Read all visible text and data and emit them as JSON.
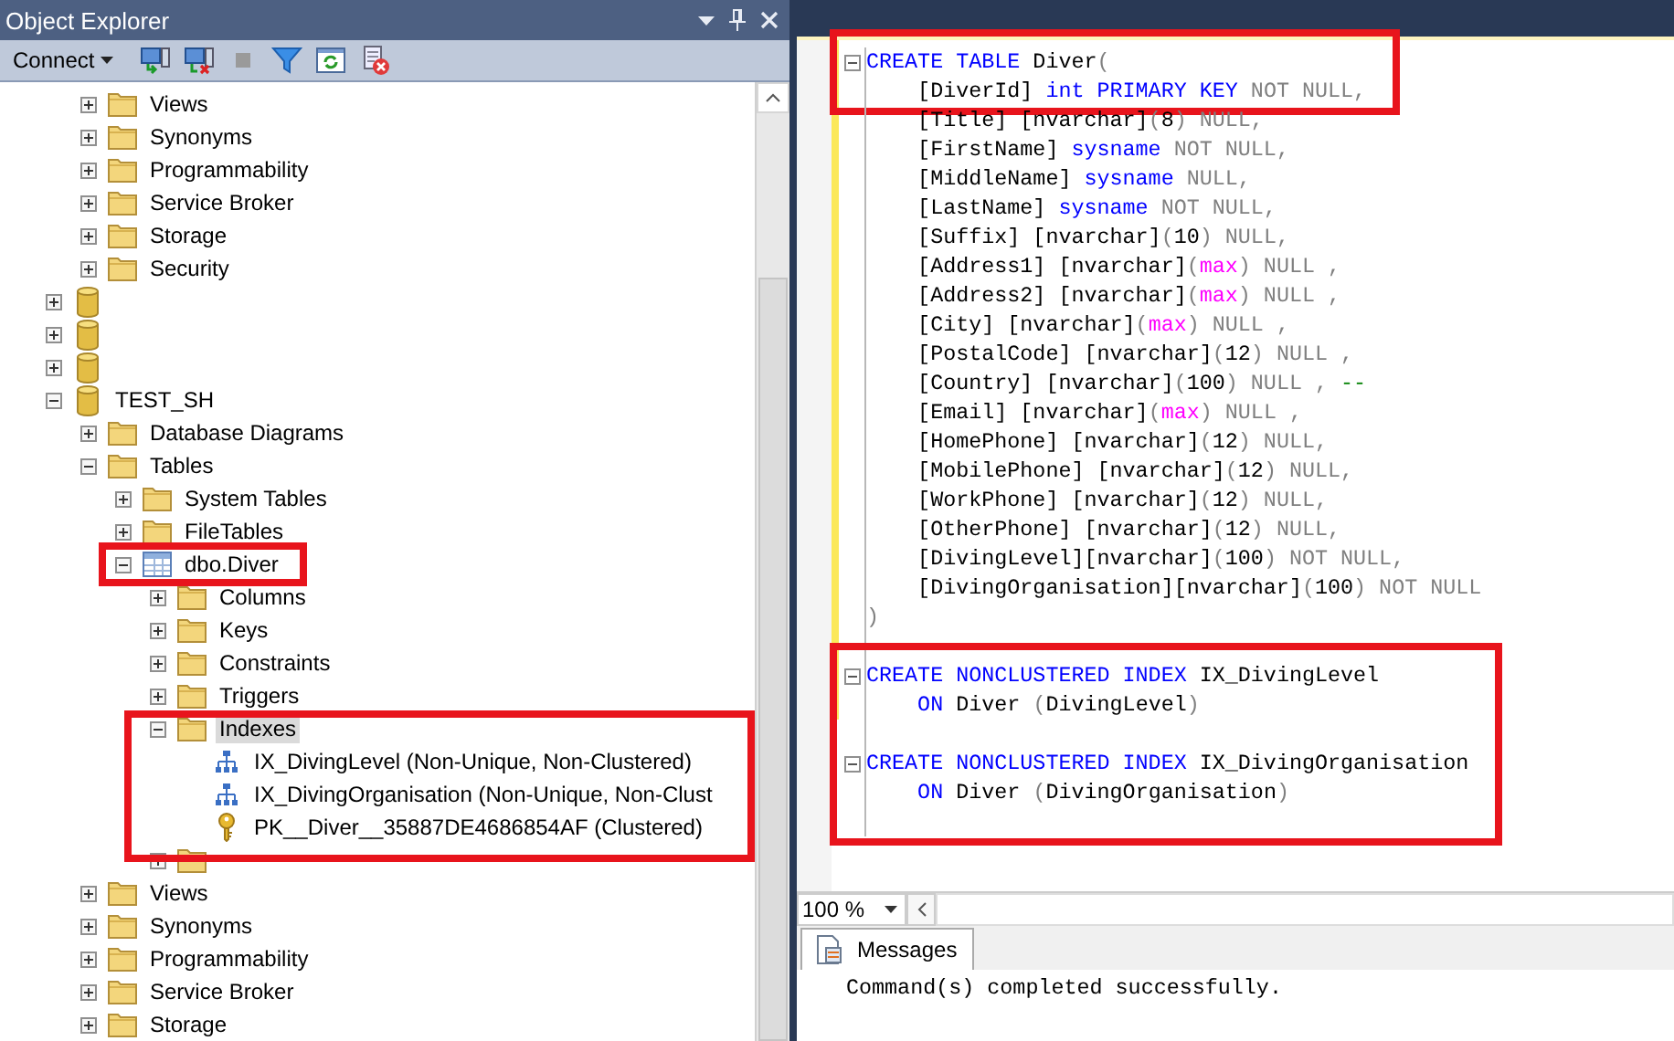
{
  "object_explorer": {
    "title": "Object Explorer",
    "connect_label": "Connect",
    "toolbar": [
      {
        "kind": "connect",
        "disabled": false
      },
      {
        "kind": "disconnect",
        "disabled": false
      },
      {
        "kind": "stop",
        "disabled": true
      },
      {
        "kind": "filter",
        "disabled": false
      },
      {
        "kind": "refresh",
        "disabled": false
      },
      {
        "kind": "script-cancel",
        "disabled": false
      }
    ],
    "tree": [
      {
        "kind": "continuation",
        "children": [
          {
            "kind": "folder",
            "label": "Views",
            "expanded": false,
            "selected": false
          },
          {
            "kind": "folder",
            "label": "Synonyms",
            "expanded": false,
            "selected": false
          },
          {
            "kind": "folder",
            "label": "Programmability",
            "expanded": false,
            "selected": false
          },
          {
            "kind": "folder",
            "label": "Service Broker",
            "expanded": false,
            "selected": false
          },
          {
            "kind": "folder",
            "label": "Storage",
            "expanded": false,
            "selected": false
          },
          {
            "kind": "folder",
            "label": "Security",
            "expanded": false,
            "selected": false
          }
        ]
      },
      {
        "kind": "database",
        "expanded": false,
        "selected": false
      },
      {
        "kind": "database",
        "expanded": false,
        "selected": false
      },
      {
        "kind": "database",
        "expanded": false,
        "selected": false
      },
      {
        "kind": "database",
        "label": "TEST_SH",
        "expanded": true,
        "selected": false,
        "children": [
          {
            "kind": "folder",
            "label": "Database Diagrams",
            "expanded": false,
            "selected": false
          },
          {
            "kind": "folder",
            "label": "Tables",
            "expanded": true,
            "selected": false,
            "children": [
              {
                "kind": "folder",
                "label": "System Tables",
                "expanded": false,
                "selected": false
              },
              {
                "kind": "folder",
                "label": "FileTables",
                "expanded": false,
                "selected": false
              },
              {
                "kind": "table",
                "label": "dbo.Diver",
                "expanded": true,
                "selected": false,
                "highlighted": true,
                "children": [
                  {
                    "kind": "folder",
                    "label": "Columns",
                    "expanded": false,
                    "selected": false
                  },
                  {
                    "kind": "folder",
                    "label": "Keys",
                    "expanded": false,
                    "selected": false
                  },
                  {
                    "kind": "folder",
                    "label": "Constraints",
                    "expanded": false,
                    "selected": false
                  },
                  {
                    "kind": "folder",
                    "label": "Triggers",
                    "expanded": false,
                    "selected": false
                  },
                  {
                    "kind": "folder",
                    "label": "Indexes",
                    "expanded": true,
                    "selected": true,
                    "highlighted": true,
                    "children": [
                      {
                        "kind": "index",
                        "label": "IX_DivingLevel (Non-Unique, Non-Clustered)",
                        "selected": false
                      },
                      {
                        "kind": "index",
                        "label": "IX_DivingOrganisation (Non-Unique, Non-Clust",
                        "selected": false
                      },
                      {
                        "kind": "key",
                        "label": "PK__Diver__35887DE4686854AF (Clustered)",
                        "selected": false
                      }
                    ]
                  },
                  {
                    "kind": "folder",
                    "expanded": false,
                    "selected": false
                  }
                ]
              }
            ]
          },
          {
            "kind": "folder",
            "label": "Views",
            "expanded": false,
            "selected": false
          },
          {
            "kind": "folder",
            "label": "Synonyms",
            "expanded": false,
            "selected": false
          },
          {
            "kind": "folder",
            "label": "Programmability",
            "expanded": false,
            "selected": false
          },
          {
            "kind": "folder",
            "label": "Service Broker",
            "expanded": false,
            "selected": false
          },
          {
            "kind": "folder",
            "label": "Storage",
            "expanded": false,
            "selected": false
          }
        ]
      }
    ]
  },
  "editor": {
    "segments": [
      {
        "highlighted": true,
        "lines": [
          {
            "kind": "code",
            "fold": true,
            "tokens": [
              {
                "kind": "keyword",
                "text": "CREATE TABLE"
              },
              {
                "kind": "plain",
                "text": " Diver"
              },
              {
                "kind": "gray",
                "text": "("
              }
            ]
          },
          {
            "kind": "code",
            "fold": false,
            "tokens": [
              {
                "kind": "plain",
                "text": "    [DiverId] "
              },
              {
                "kind": "keyword",
                "text": "int PRIMARY KEY"
              },
              {
                "kind": "gray",
                "text": " NOT NULL,"
              }
            ]
          }
        ]
      },
      {
        "highlighted": false,
        "lines": [
          {
            "kind": "code",
            "fold": false,
            "tokens": [
              {
                "kind": "plain",
                "text": "    [Title] [nvarchar]"
              },
              {
                "kind": "gray",
                "text": "("
              },
              {
                "kind": "plain",
                "text": "8"
              },
              {
                "kind": "gray",
                "text": ") NULL,"
              }
            ]
          },
          {
            "kind": "code",
            "fold": false,
            "tokens": [
              {
                "kind": "plain",
                "text": "    [FirstName] "
              },
              {
                "kind": "keyword",
                "text": "sysname"
              },
              {
                "kind": "gray",
                "text": " NOT NULL,"
              }
            ]
          },
          {
            "kind": "code",
            "fold": false,
            "tokens": [
              {
                "kind": "plain",
                "text": "    [MiddleName] "
              },
              {
                "kind": "keyword",
                "text": "sysname"
              },
              {
                "kind": "gray",
                "text": " NULL,"
              }
            ]
          },
          {
            "kind": "code",
            "fold": false,
            "tokens": [
              {
                "kind": "plain",
                "text": "    [LastName] "
              },
              {
                "kind": "keyword",
                "text": "sysname"
              },
              {
                "kind": "gray",
                "text": " NOT NULL,"
              }
            ]
          },
          {
            "kind": "code",
            "fold": false,
            "tokens": [
              {
                "kind": "plain",
                "text": "    [Suffix] [nvarchar]"
              },
              {
                "kind": "gray",
                "text": "("
              },
              {
                "kind": "plain",
                "text": "10"
              },
              {
                "kind": "gray",
                "text": ") NULL,"
              }
            ]
          },
          {
            "kind": "code",
            "fold": false,
            "tokens": [
              {
                "kind": "plain",
                "text": "    [Address1] [nvarchar]"
              },
              {
                "kind": "gray",
                "text": "("
              },
              {
                "kind": "magenta",
                "text": "max"
              },
              {
                "kind": "gray",
                "text": ") NULL ,"
              }
            ]
          },
          {
            "kind": "code",
            "fold": false,
            "tokens": [
              {
                "kind": "plain",
                "text": "    [Address2] [nvarchar]"
              },
              {
                "kind": "gray",
                "text": "("
              },
              {
                "kind": "magenta",
                "text": "max"
              },
              {
                "kind": "gray",
                "text": ") NULL ,"
              }
            ]
          },
          {
            "kind": "code",
            "fold": false,
            "tokens": [
              {
                "kind": "plain",
                "text": "    [City] [nvarchar]"
              },
              {
                "kind": "gray",
                "text": "("
              },
              {
                "kind": "magenta",
                "text": "max"
              },
              {
                "kind": "gray",
                "text": ") NULL ,"
              }
            ]
          },
          {
            "kind": "code",
            "fold": false,
            "tokens": [
              {
                "kind": "plain",
                "text": "    [PostalCode] [nvarchar]"
              },
              {
                "kind": "gray",
                "text": "("
              },
              {
                "kind": "plain",
                "text": "12"
              },
              {
                "kind": "gray",
                "text": ") NULL ,"
              }
            ]
          },
          {
            "kind": "code",
            "fold": false,
            "tokens": [
              {
                "kind": "plain",
                "text": "    [Country] [nvarchar]"
              },
              {
                "kind": "gray",
                "text": "("
              },
              {
                "kind": "plain",
                "text": "100"
              },
              {
                "kind": "gray",
                "text": ") NULL ,"
              },
              {
                "kind": "comment",
                "text": " --"
              }
            ]
          },
          {
            "kind": "code",
            "fold": false,
            "tokens": [
              {
                "kind": "plain",
                "text": "    [Email] [nvarchar]"
              },
              {
                "kind": "gray",
                "text": "("
              },
              {
                "kind": "magenta",
                "text": "max"
              },
              {
                "kind": "gray",
                "text": ") NULL ,"
              }
            ]
          },
          {
            "kind": "code",
            "fold": false,
            "tokens": [
              {
                "kind": "plain",
                "text": "    [HomePhone] [nvarchar]"
              },
              {
                "kind": "gray",
                "text": "("
              },
              {
                "kind": "plain",
                "text": "12"
              },
              {
                "kind": "gray",
                "text": ") NULL,"
              }
            ]
          },
          {
            "kind": "code",
            "fold": false,
            "tokens": [
              {
                "kind": "plain",
                "text": "    [MobilePhone] [nvarchar]"
              },
              {
                "kind": "gray",
                "text": "("
              },
              {
                "kind": "plain",
                "text": "12"
              },
              {
                "kind": "gray",
                "text": ") NULL,"
              }
            ]
          },
          {
            "kind": "code",
            "fold": false,
            "tokens": [
              {
                "kind": "plain",
                "text": "    [WorkPhone] [nvarchar]"
              },
              {
                "kind": "gray",
                "text": "("
              },
              {
                "kind": "plain",
                "text": "12"
              },
              {
                "kind": "gray",
                "text": ") NULL,"
              }
            ]
          },
          {
            "kind": "code",
            "fold": false,
            "tokens": [
              {
                "kind": "plain",
                "text": "    [OtherPhone] [nvarchar]"
              },
              {
                "kind": "gray",
                "text": "("
              },
              {
                "kind": "plain",
                "text": "12"
              },
              {
                "kind": "gray",
                "text": ") NULL,"
              }
            ]
          },
          {
            "kind": "code",
            "fold": false,
            "tokens": [
              {
                "kind": "plain",
                "text": "    [DivingLevel][nvarchar]"
              },
              {
                "kind": "gray",
                "text": "("
              },
              {
                "kind": "plain",
                "text": "100"
              },
              {
                "kind": "gray",
                "text": ") NOT NULL,"
              }
            ]
          },
          {
            "kind": "code",
            "fold": false,
            "tokens": [
              {
                "kind": "plain",
                "text": "    [DivingOrganisation][nvarchar]"
              },
              {
                "kind": "gray",
                "text": "("
              },
              {
                "kind": "plain",
                "text": "100"
              },
              {
                "kind": "gray",
                "text": ") NOT NULL"
              }
            ]
          },
          {
            "kind": "code",
            "fold": false,
            "tokens": [
              {
                "kind": "gray",
                "text": ")"
              }
            ]
          },
          {
            "kind": "blank"
          }
        ]
      },
      {
        "highlighted": true,
        "lines": [
          {
            "kind": "code",
            "fold": true,
            "tokens": [
              {
                "kind": "keyword",
                "text": "CREATE NONCLUSTERED INDEX"
              },
              {
                "kind": "plain",
                "text": " IX_DivingLevel"
              }
            ]
          },
          {
            "kind": "code",
            "fold": false,
            "tokens": [
              {
                "kind": "keyword",
                "text": "    ON"
              },
              {
                "kind": "plain",
                "text": " Diver "
              },
              {
                "kind": "gray",
                "text": "("
              },
              {
                "kind": "plain",
                "text": "DivingLevel"
              },
              {
                "kind": "gray",
                "text": ")"
              }
            ]
          },
          {
            "kind": "blank"
          },
          {
            "kind": "code",
            "fold": true,
            "tokens": [
              {
                "kind": "keyword",
                "text": "CREATE NONCLUSTERED INDEX"
              },
              {
                "kind": "plain",
                "text": " IX_DivingOrganisation"
              }
            ]
          },
          {
            "kind": "code",
            "fold": false,
            "tokens": [
              {
                "kind": "keyword",
                "text": "    ON"
              },
              {
                "kind": "plain",
                "text": " Diver "
              },
              {
                "kind": "gray",
                "text": "("
              },
              {
                "kind": "plain",
                "text": "DivingOrganisation"
              },
              {
                "kind": "gray",
                "text": ")"
              }
            ]
          },
          {
            "kind": "blank"
          }
        ]
      }
    ],
    "zoom": "100 %"
  },
  "results": {
    "tabs": [
      {
        "label": "Messages",
        "selected": true
      }
    ],
    "message": "Command(s) completed successfully."
  }
}
